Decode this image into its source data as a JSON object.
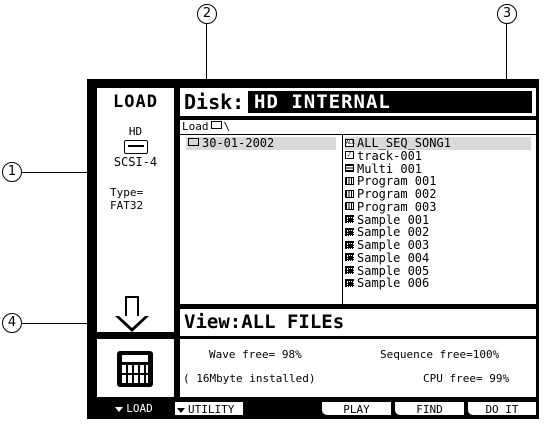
{
  "callouts": [
    "1",
    "2",
    "3",
    "4"
  ],
  "left_panel": {
    "title": "LOAD",
    "device": "HD",
    "drive_icon": "hard-drive-icon",
    "scsi": "SCSI-4",
    "type_label": "Type=",
    "type_value": "FAT32",
    "sampler_icon": "sampler-icon"
  },
  "disk": {
    "label": "Disk:",
    "value": "HD INTERNAL"
  },
  "path": {
    "text": "Load",
    "folder_icon": "folder-icon",
    "separator": "\\"
  },
  "directories": [
    "30-01-2002"
  ],
  "files": [
    {
      "name": "ALL_SEQ_SONG1",
      "icon": "all-seq-icon",
      "selected": true
    },
    {
      "name": "track-001",
      "icon": "sequence-icon"
    },
    {
      "name": "Multi 001",
      "icon": "multi-icon"
    },
    {
      "name": "Program 001",
      "icon": "program-icon"
    },
    {
      "name": "Program 002",
      "icon": "program-icon"
    },
    {
      "name": "Program 003",
      "icon": "program-icon"
    },
    {
      "name": "Sample 001",
      "icon": "sample-icon"
    },
    {
      "name": "Sample 002",
      "icon": "sample-icon"
    },
    {
      "name": "Sample 003",
      "icon": "sample-icon"
    },
    {
      "name": "Sample 004",
      "icon": "sample-icon"
    },
    {
      "name": "Sample 005",
      "icon": "sample-icon"
    },
    {
      "name": "Sample 006",
      "icon": "sample-icon"
    }
  ],
  "view": {
    "label": "View:",
    "value": "ALL FILEs"
  },
  "status": {
    "wave_free": "Wave free= 98%",
    "sequence_free": "Sequence free=100%",
    "installed": "( 16Mbyte installed)",
    "cpu_free": "CPU free= 99%"
  },
  "function_keys": {
    "load": "LOAD",
    "utility": "UTILITY",
    "play": "PLAY",
    "find": "FIND",
    "do_it": "DO IT"
  }
}
